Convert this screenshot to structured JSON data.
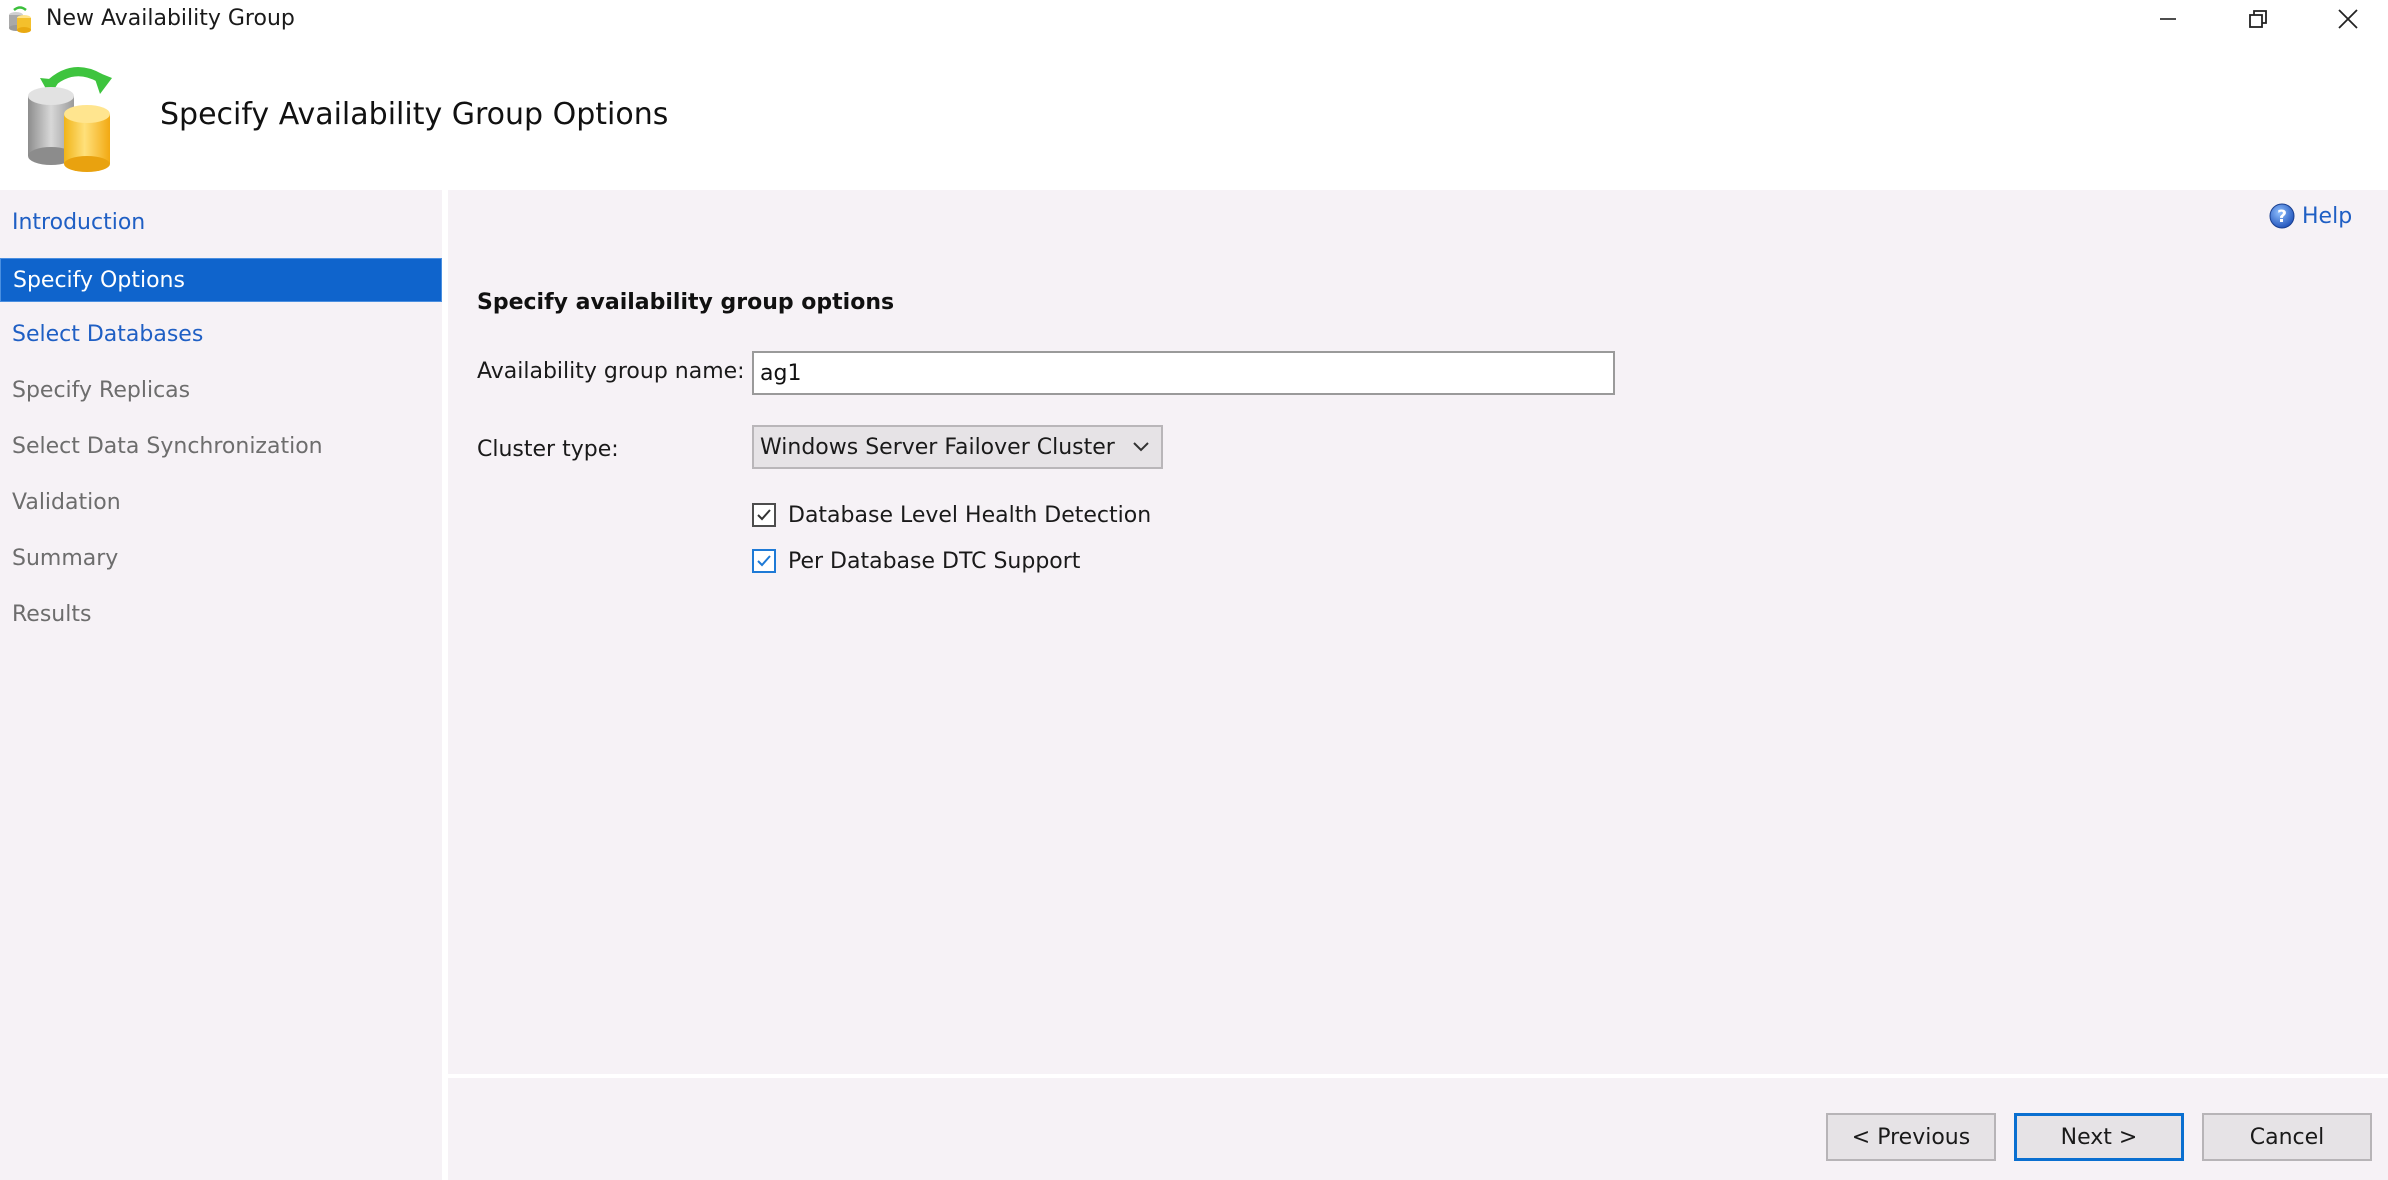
{
  "window": {
    "title": "New Availability Group",
    "icons": {
      "app": "database-sync-icon",
      "minimize": "minimize-icon",
      "maximize": "restore-icon",
      "close": "close-icon"
    }
  },
  "header": {
    "title": "Specify Availability Group Options",
    "icon": "database-sync-icon"
  },
  "sidebar": {
    "items": [
      {
        "label": "Introduction",
        "state": "link"
      },
      {
        "label": "Specify Options",
        "state": "active"
      },
      {
        "label": "Select Databases",
        "state": "link"
      },
      {
        "label": "Specify Replicas",
        "state": "disabled"
      },
      {
        "label": "Select Data Synchronization",
        "state": "disabled"
      },
      {
        "label": "Validation",
        "state": "disabled"
      },
      {
        "label": "Summary",
        "state": "disabled"
      },
      {
        "label": "Results",
        "state": "disabled"
      }
    ]
  },
  "main": {
    "help_label": "Help",
    "help_icon": "help-icon",
    "section_title": "Specify availability group options",
    "name_label": "Availability group name:",
    "name_value": "ag1",
    "cluster_label": "Cluster type:",
    "cluster_value": "Windows Server Failover Cluster",
    "checkboxes": [
      {
        "label": "Database Level Health Detection",
        "checked": true
      },
      {
        "label": "Per Database DTC Support",
        "checked": true
      }
    ]
  },
  "footer": {
    "previous_label": "< Previous",
    "next_label": "Next >",
    "cancel_label": "Cancel"
  },
  "colors": {
    "accent": "#0f64cc",
    "link": "#1f5fc4",
    "disabled_text": "#6d6d6d",
    "pane_bg": "#f6f2f6",
    "focus_border": "#0a6fd0"
  }
}
